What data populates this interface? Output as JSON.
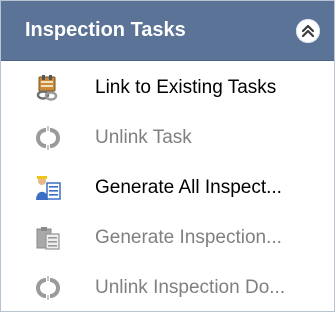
{
  "panel": {
    "title": "Inspection Tasks",
    "collapse_icon": "double-chevron-up-icon"
  },
  "items": [
    {
      "label": "Link to Existing Tasks",
      "icon": "link-tasks-icon",
      "enabled": true
    },
    {
      "label": "Unlink Task",
      "icon": "unlink-icon",
      "enabled": false
    },
    {
      "label": "Generate All Inspect...",
      "icon": "generate-all-inspections-icon",
      "enabled": true
    },
    {
      "label": "Generate Inspection...",
      "icon": "generate-inspection-icon",
      "enabled": false
    },
    {
      "label": "Unlink Inspection Do...",
      "icon": "unlink-icon",
      "enabled": false
    }
  ],
  "colors": {
    "header_bg": "#5b7396",
    "header_text": "#ffffff",
    "enabled_text": "#000000",
    "disabled_text": "#808080"
  }
}
